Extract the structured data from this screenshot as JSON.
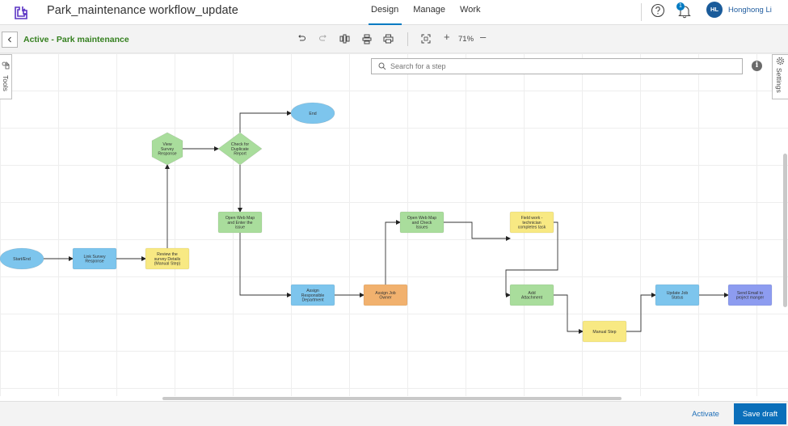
{
  "header": {
    "app_title": "Park_maintenance workflow_update",
    "tabs": [
      {
        "label": "Design",
        "active": true
      },
      {
        "label": "Manage",
        "active": false
      },
      {
        "label": "Work",
        "active": false
      }
    ],
    "notification_count": "1",
    "user": {
      "initials": "HL",
      "name": "Honghong Li"
    }
  },
  "toolbar": {
    "workflow_name": "Active - Park maintenance",
    "zoom": "71%",
    "zoom_in": "+",
    "zoom_out": "–"
  },
  "side_tabs": {
    "tools": "Tools",
    "settings": "Settings"
  },
  "search": {
    "placeholder": "Search for a step"
  },
  "info": "i",
  "footer": {
    "activate": "Activate",
    "save_draft": "Save draft"
  },
  "colors": {
    "blue_step": "#7dc5ed",
    "green_step": "#a9dd9c",
    "yellow_step": "#f8e983",
    "orange_step": "#f1b16e",
    "purple_step": "#8d9cf0",
    "accent": "#007ac2",
    "title_green": "#35801f"
  },
  "diagram": {
    "nodes": [
      {
        "id": "start",
        "shape": "ellipse",
        "color": "blue",
        "lines": [
          "Start/End"
        ]
      },
      {
        "id": "link",
        "shape": "rect",
        "color": "blue",
        "lines": [
          "Link Survey",
          "Response"
        ]
      },
      {
        "id": "review",
        "shape": "rect",
        "color": "yellow",
        "lines": [
          "Review the",
          "survey Details",
          "(Manual Step)"
        ]
      },
      {
        "id": "view",
        "shape": "hexagon",
        "color": "green",
        "lines": [
          "View",
          "Survey",
          "Response"
        ]
      },
      {
        "id": "check",
        "shape": "diamond",
        "color": "green",
        "lines": [
          "Check for",
          "Duplicate",
          "Report"
        ]
      },
      {
        "id": "end",
        "shape": "ellipse",
        "color": "blue",
        "lines": [
          "End"
        ]
      },
      {
        "id": "openweb1",
        "shape": "rect",
        "color": "green",
        "lines": [
          "Open Web Map",
          "and Enter the",
          "issue"
        ]
      },
      {
        "id": "assignresp",
        "shape": "rect",
        "color": "blue",
        "lines": [
          "Assign",
          "Responsible",
          "Department"
        ]
      },
      {
        "id": "assignjob",
        "shape": "rect",
        "color": "orange",
        "lines": [
          "Assign Job",
          "Owner"
        ]
      },
      {
        "id": "openweb2",
        "shape": "rect",
        "color": "green",
        "lines": [
          "Open Web Map",
          "and Check",
          "Issues"
        ]
      },
      {
        "id": "fieldwork",
        "shape": "rect",
        "color": "yellow",
        "lines": [
          "Field work -",
          "technician",
          "completes task"
        ]
      },
      {
        "id": "attach",
        "shape": "rect",
        "color": "green",
        "lines": [
          "Add",
          "Attachment"
        ]
      },
      {
        "id": "manual",
        "shape": "rect",
        "color": "yellow",
        "lines": [
          "Manual Step"
        ]
      },
      {
        "id": "update",
        "shape": "rect",
        "color": "blue",
        "lines": [
          "Update Job",
          "Status"
        ]
      },
      {
        "id": "email",
        "shape": "rect",
        "color": "purple",
        "lines": [
          "Send Email to",
          "project manger"
        ]
      }
    ],
    "edges": [
      [
        "start",
        "link"
      ],
      [
        "link",
        "review"
      ],
      [
        "review",
        "view"
      ],
      [
        "view",
        "check"
      ],
      [
        "check",
        "end"
      ],
      [
        "check",
        "openweb1"
      ],
      [
        "openweb1",
        "assignresp"
      ],
      [
        "assignresp",
        "assignjob"
      ],
      [
        "assignjob",
        "openweb2"
      ],
      [
        "openweb2",
        "fieldwork"
      ],
      [
        "fieldwork",
        "attach"
      ],
      [
        "attach",
        "manual"
      ],
      [
        "manual",
        "update"
      ],
      [
        "update",
        "email"
      ]
    ]
  }
}
